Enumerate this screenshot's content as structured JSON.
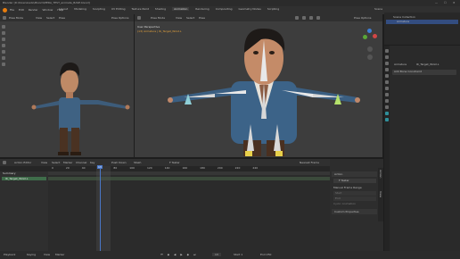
{
  "window": {
    "title": "Blender [D:\\Downloads\\Mixom\\MERA_TEST_animate_BASE.blend]"
  },
  "menu": {
    "items": [
      "File",
      "Edit",
      "Render",
      "Window",
      "Help"
    ]
  },
  "workspaces": {
    "tabs": [
      "Layout",
      "Modeling",
      "Sculpting",
      "UV Editing",
      "Texture Paint",
      "Shading",
      "Animation",
      "Rendering",
      "Compositing",
      "Geometry Nodes",
      "Scripting"
    ],
    "active": "Animation"
  },
  "top_right": {
    "scene": "Scene",
    "view_layer": "ViewLayer"
  },
  "viewport_left": {
    "mode": "Pose Mode",
    "menus": [
      "View",
      "Select",
      "Pose"
    ],
    "options": "Pose Options"
  },
  "viewport_right": {
    "mode": "Pose Mode",
    "menus": [
      "View",
      "Select",
      "Pose"
    ],
    "options": "Pose Options",
    "overlay_line1": "User Perspective",
    "overlay_line2": "(13) Armature | IK_Target_Wrist.L"
  },
  "outliner": {
    "title": "Scene Collection",
    "row": "Armature"
  },
  "properties": {
    "object": "Armature",
    "bone": "IK_Target_Wrist.L",
    "add_constraint": "Add Bone Constraint"
  },
  "action_editor": {
    "mode": "Action Editor",
    "menus": [
      "View",
      "Select",
      "Marker",
      "Channel",
      "Key"
    ],
    "push_down": "Push Down",
    "stash": "Stash",
    "action_name": "F Tester",
    "channel_summary": "Summary",
    "channel_row": "IK_Target_Wrist.L",
    "ruler": [
      "0",
      "20",
      "40",
      "60",
      "80",
      "100",
      "120",
      "140",
      "160",
      "180",
      "200",
      "220",
      "240"
    ],
    "current_frame": "13",
    "nearest_frame": "Nearest Frame"
  },
  "npanel": {
    "section": "Action",
    "action": "F Tester",
    "manual_range": "Manual Frame Range",
    "start_label": "Start",
    "end_label": "End",
    "cyclic": "Cyclic Animation",
    "custom_props": "Custom Properties",
    "tabs": [
      "Action",
      "View"
    ]
  },
  "status_bar": {
    "items": [
      "Playback",
      "Keying",
      "View",
      "Marker"
    ],
    "frame": "13",
    "start": "Start 1",
    "end": "End 250"
  }
}
